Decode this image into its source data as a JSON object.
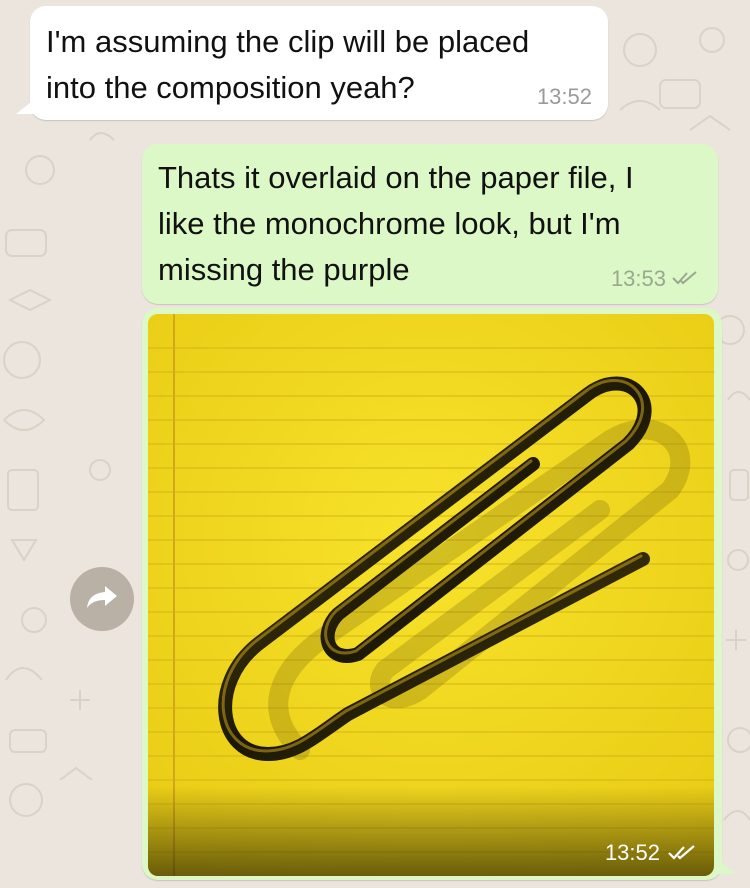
{
  "chat": {
    "messages": [
      {
        "direction": "incoming",
        "text": "I'm assuming the clip will be placed\ninto the composition yeah?",
        "time": "13:52"
      },
      {
        "direction": "outgoing",
        "text": "Thats it overlaid on the paper file, I\nlike the monochrome look, but I'm\nmissing the purple",
        "time": "13:53",
        "status_icon": "double-check-icon"
      },
      {
        "direction": "outgoing",
        "type": "image",
        "image_subject": "paperclip-on-lined-yellow-paper",
        "time": "13:52",
        "status_icon": "double-check-icon"
      }
    ]
  },
  "actions": {
    "forward_icon": "forward-arrow-icon"
  },
  "colors": {
    "wallpaper": "#ece5dd",
    "incoming_bubble": "#ffffff",
    "outgoing_bubble": "#dcf8c6",
    "photo_paper": "#f2d91f",
    "forward_button": "#b9b0a6"
  }
}
